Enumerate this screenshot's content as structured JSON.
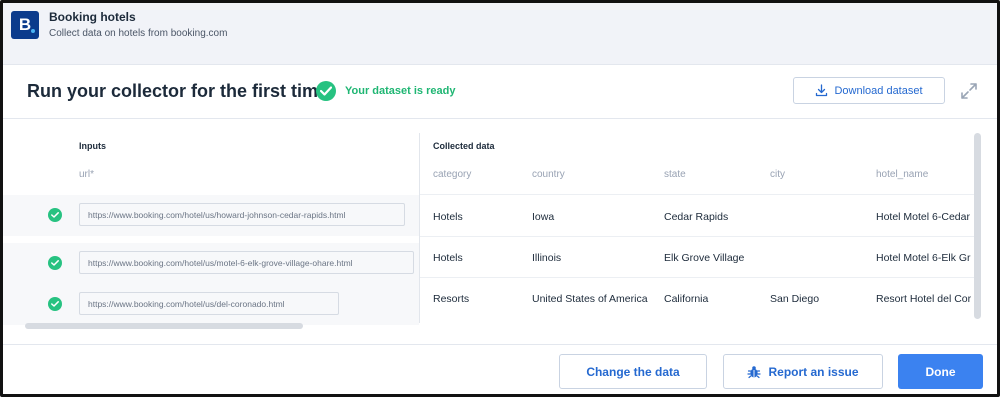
{
  "app": {
    "logo_letter": "B",
    "title": "Booking hotels",
    "subtitle": "Collect data on hotels from booking.com"
  },
  "run": {
    "title": "Run your collector for the first time",
    "status_text": "Your dataset is ready",
    "download_label": "Download dataset"
  },
  "inputs": {
    "header": "Inputs",
    "column_label": "url*",
    "rows": [
      {
        "url": "https://www.booking.com/hotel/us/howard-johnson-cedar-rapids.html"
      },
      {
        "url": "https://www.booking.com/hotel/us/motel-6-elk-grove-village-ohare.html"
      },
      {
        "url": "https://www.booking.com/hotel/us/del-coronado.html"
      }
    ]
  },
  "collected": {
    "header": "Collected data",
    "columns": [
      "category",
      "country",
      "state",
      "city",
      "hotel_name"
    ],
    "rows": [
      [
        "Hotels",
        "Iowa",
        "Cedar Rapids",
        "",
        "Hotel Motel 6-Cedar"
      ],
      [
        "Hotels",
        "Illinois",
        "Elk Grove Village",
        "",
        "Hotel Motel 6-Elk Gr"
      ],
      [
        "Resorts",
        "United States of America",
        "California",
        "San Diego",
        "Resort Hotel del Cor"
      ]
    ]
  },
  "footer": {
    "change_label": "Change the data",
    "report_label": "Report an issue",
    "done_label": "Done"
  },
  "colors": {
    "brand": "#0b3b8c",
    "accent": "#3b82f0",
    "success": "#27c281"
  },
  "icons": [
    "check-circle-icon",
    "download-icon",
    "expand-icon",
    "bug-icon"
  ]
}
